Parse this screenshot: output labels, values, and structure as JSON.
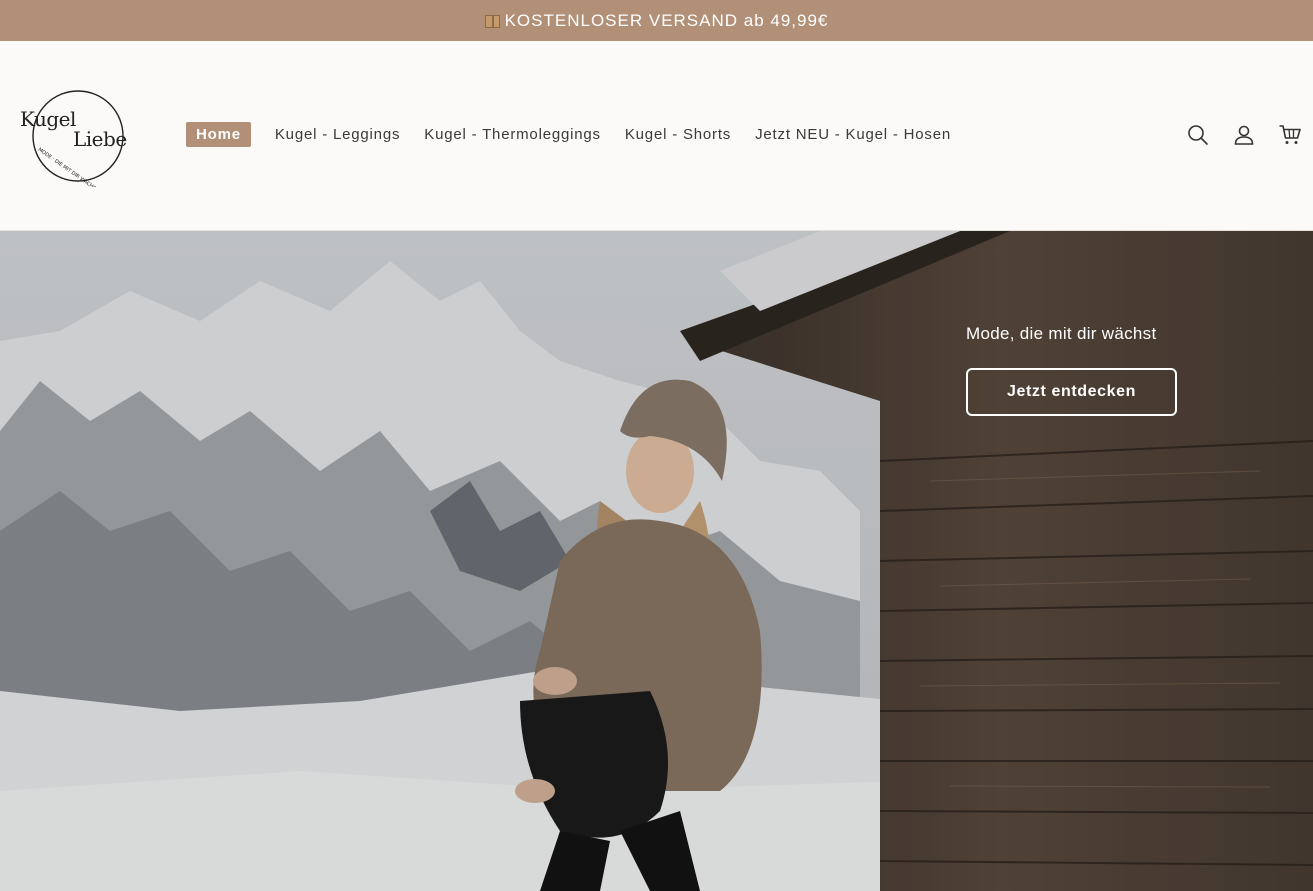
{
  "announcement": {
    "text": "KOSTENLOSER VERSAND ab 49,99€",
    "icon": "package-icon"
  },
  "logo": {
    "line1": "Kugel",
    "line2": "Liebe",
    "tagline": "MODE · DIE MIT DIR WÄCHST"
  },
  "nav": {
    "items": [
      {
        "label": "Home",
        "active": true
      },
      {
        "label": "Kugel - Leggings"
      },
      {
        "label": "Kugel - Thermoleggings"
      },
      {
        "label": "Kugel - Shorts"
      },
      {
        "label": "Jetzt NEU - Kugel - Hosen"
      }
    ]
  },
  "header_icons": [
    "search-icon",
    "account-icon",
    "cart-icon"
  ],
  "hero": {
    "subtitle": "Mode, die mit dir wächst",
    "button_label": "Jetzt entdecken"
  },
  "colors": {
    "accent": "#b19077",
    "header_bg": "#fbfaf8",
    "text": "#2b2b2b"
  }
}
